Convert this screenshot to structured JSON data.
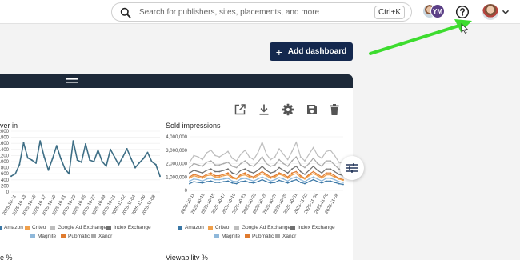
{
  "topbar": {
    "search_placeholder": "Search for publishers, sites, placements, and more",
    "search_shortcut": "Ctrl+K",
    "avatar_initials": "YM"
  },
  "toolbar": {
    "add_dashboard_label": "Add dashboard"
  },
  "charts": [
    {
      "title": "ver in",
      "legend": [
        "Amazon",
        "Criteo",
        "Google Ad Exchange",
        "Index Exchange",
        "Magnite",
        "Pubmatic",
        "Xandr"
      ]
    },
    {
      "title": "Sold impressions",
      "legend": [
        "Amazon",
        "Criteo",
        "Google Ad Exchange",
        "Index Exchange",
        "Magnite",
        "Pubmatic",
        "Xandr"
      ]
    },
    {
      "title": "e %"
    },
    {
      "title": "Viewability %"
    }
  ],
  "colors": {
    "navy": "#14284e",
    "amazon": "#3a77a6",
    "criteo": "#f0a04b",
    "google_ad_exchange": "#bdbdbd",
    "index_exchange": "#707070",
    "magnite": "#8fb8da",
    "pubmatic": "#e07b2f",
    "xandr": "#a8a8a8",
    "annotation_arrow": "#3ddc2f"
  },
  "icons": [
    "search-icon",
    "help-icon",
    "chevron-down-icon",
    "plus-icon",
    "drag-handle-icon",
    "open-external-icon",
    "download-icon",
    "gear-icon",
    "save-icon",
    "trash-icon",
    "filter-sliders-icon",
    "cursor-icon"
  ],
  "chart_data": [
    {
      "type": "line",
      "title": "ver in",
      "x": [
        "2025-10-11",
        "2025-10-13",
        "2025-10-15",
        "2025-10-17",
        "2025-10-19",
        "2025-10-21",
        "2025-10-23",
        "2025-10-25",
        "2025-10-27",
        "2025-10-29",
        "2025-10-31",
        "2025-11-02",
        "2025-11-04",
        "2025-11-06",
        "2025-11-08"
      ],
      "y_ticks": [
        "0",
        "200",
        "400",
        "600",
        "800",
        "1000",
        "1200",
        "1400",
        "1600",
        "1800",
        "2000"
      ],
      "ylim": [
        0,
        2000
      ],
      "series": [
        {
          "values": [
            520,
            600,
            900,
            1620,
            1120,
            1050,
            950,
            1680,
            1150,
            720,
            1100,
            1520,
            1100,
            760,
            600,
            1680,
            1050,
            980,
            1580,
            1050,
            1000,
            1380,
            1000,
            850,
            1400,
            1150,
            900,
            1150,
            1420,
            1100,
            800,
            960,
            1100,
            1300,
            1000,
            900,
            520
          ]
        }
      ]
    },
    {
      "type": "line",
      "title": "Sold impressions",
      "x": [
        "2025-10-11",
        "2025-10-13",
        "2025-10-15",
        "2025-10-17",
        "2025-10-19",
        "2025-10-21",
        "2025-10-23",
        "2025-10-25",
        "2025-10-27",
        "2025-10-29",
        "2025-10-31",
        "2025-11-02",
        "2025-11-04",
        "2025-11-06",
        "2025-11-08"
      ],
      "y_ticks": [
        "0",
        "1,000,000",
        "2,000,000",
        "3,000,000",
        "4,000,000"
      ],
      "ylim": [
        0,
        4000000
      ],
      "series": [
        {
          "name": "Google Ad Exchange",
          "values": [
            2100000,
            2600000,
            2500000,
            2300000,
            2800000,
            3000000,
            2600000,
            2500000,
            2700000,
            2900000,
            2400000,
            2200000,
            2700000,
            3000000,
            2500000,
            2300000,
            2800000,
            3600000,
            2700000,
            2300000,
            2500000,
            3100000,
            2700000,
            2300000,
            2900000,
            3600000,
            2500000,
            2200000,
            2700000,
            3200000,
            2600000,
            2400000,
            2900000,
            3000000,
            2600000,
            2100000,
            2000000
          ]
        },
        {
          "name": "Xandr",
          "values": [
            1700000,
            2000000,
            1900000,
            1800000,
            2100000,
            2200000,
            1900000,
            1900000,
            2000000,
            2100000,
            1800000,
            1700000,
            2000000,
            2200000,
            1900000,
            1800000,
            2100000,
            2500000,
            2000000,
            1800000,
            1900000,
            2300000,
            2000000,
            1800000,
            2200000,
            2500000,
            1900000,
            1700000,
            2000000,
            2400000,
            2000000,
            1800000,
            2200000,
            2200000,
            1900000,
            1600000,
            1500000
          ]
        },
        {
          "name": "Index Exchange",
          "values": [
            1300000,
            1500000,
            1400000,
            1300000,
            1500000,
            1600000,
            1400000,
            1400000,
            1500000,
            1600000,
            1300000,
            1200000,
            1500000,
            1600000,
            1400000,
            1300000,
            1500000,
            1800000,
            1500000,
            1300000,
            1400000,
            1700000,
            1500000,
            1300000,
            1600000,
            1800000,
            1400000,
            1200000,
            1500000,
            1800000,
            1500000,
            1300000,
            1600000,
            1600000,
            1400000,
            1200000,
            1100000
          ]
        },
        {
          "name": "Pubmatic",
          "values": [
            1000000,
            1200000,
            1100000,
            1000000,
            1200000,
            1300000,
            1100000,
            1100000,
            1200000,
            1300000,
            1000000,
            900000,
            1200000,
            1300000,
            1100000,
            1000000,
            1200000,
            1400000,
            1200000,
            1000000,
            1100000,
            1300000,
            1200000,
            1000000,
            1300000,
            1400000,
            1100000,
            900000,
            1200000,
            1400000,
            1200000,
            1000000,
            1300000,
            1300000,
            1100000,
            900000,
            800000
          ]
        },
        {
          "name": "Criteo",
          "values": [
            900000,
            1100000,
            1000000,
            900000,
            1100000,
            1150000,
            1000000,
            1000000,
            1100000,
            1150000,
            900000,
            850000,
            1100000,
            1150000,
            1000000,
            900000,
            1100000,
            1250000,
            1100000,
            900000,
            1000000,
            1200000,
            1100000,
            900000,
            1150000,
            1250000,
            1000000,
            850000,
            1100000,
            1250000,
            1100000,
            900000,
            1150000,
            1150000,
            1000000,
            850000,
            750000
          ]
        },
        {
          "name": "Magnite",
          "values": [
            700000,
            850000,
            800000,
            700000,
            850000,
            900000,
            800000,
            800000,
            850000,
            900000,
            700000,
            650000,
            850000,
            900000,
            800000,
            700000,
            850000,
            1000000,
            850000,
            700000,
            800000,
            950000,
            850000,
            700000,
            900000,
            1000000,
            800000,
            650000,
            850000,
            1000000,
            850000,
            700000,
            900000,
            900000,
            800000,
            650000,
            600000
          ]
        },
        {
          "name": "Amazon",
          "values": [
            500000,
            650000,
            600000,
            550000,
            650000,
            700000,
            600000,
            600000,
            650000,
            700000,
            550000,
            500000,
            650000,
            700000,
            600000,
            550000,
            650000,
            800000,
            650000,
            550000,
            600000,
            750000,
            650000,
            550000,
            700000,
            800000,
            600000,
            500000,
            650000,
            800000,
            650000,
            550000,
            700000,
            700000,
            600000,
            500000,
            450000
          ]
        }
      ]
    }
  ]
}
